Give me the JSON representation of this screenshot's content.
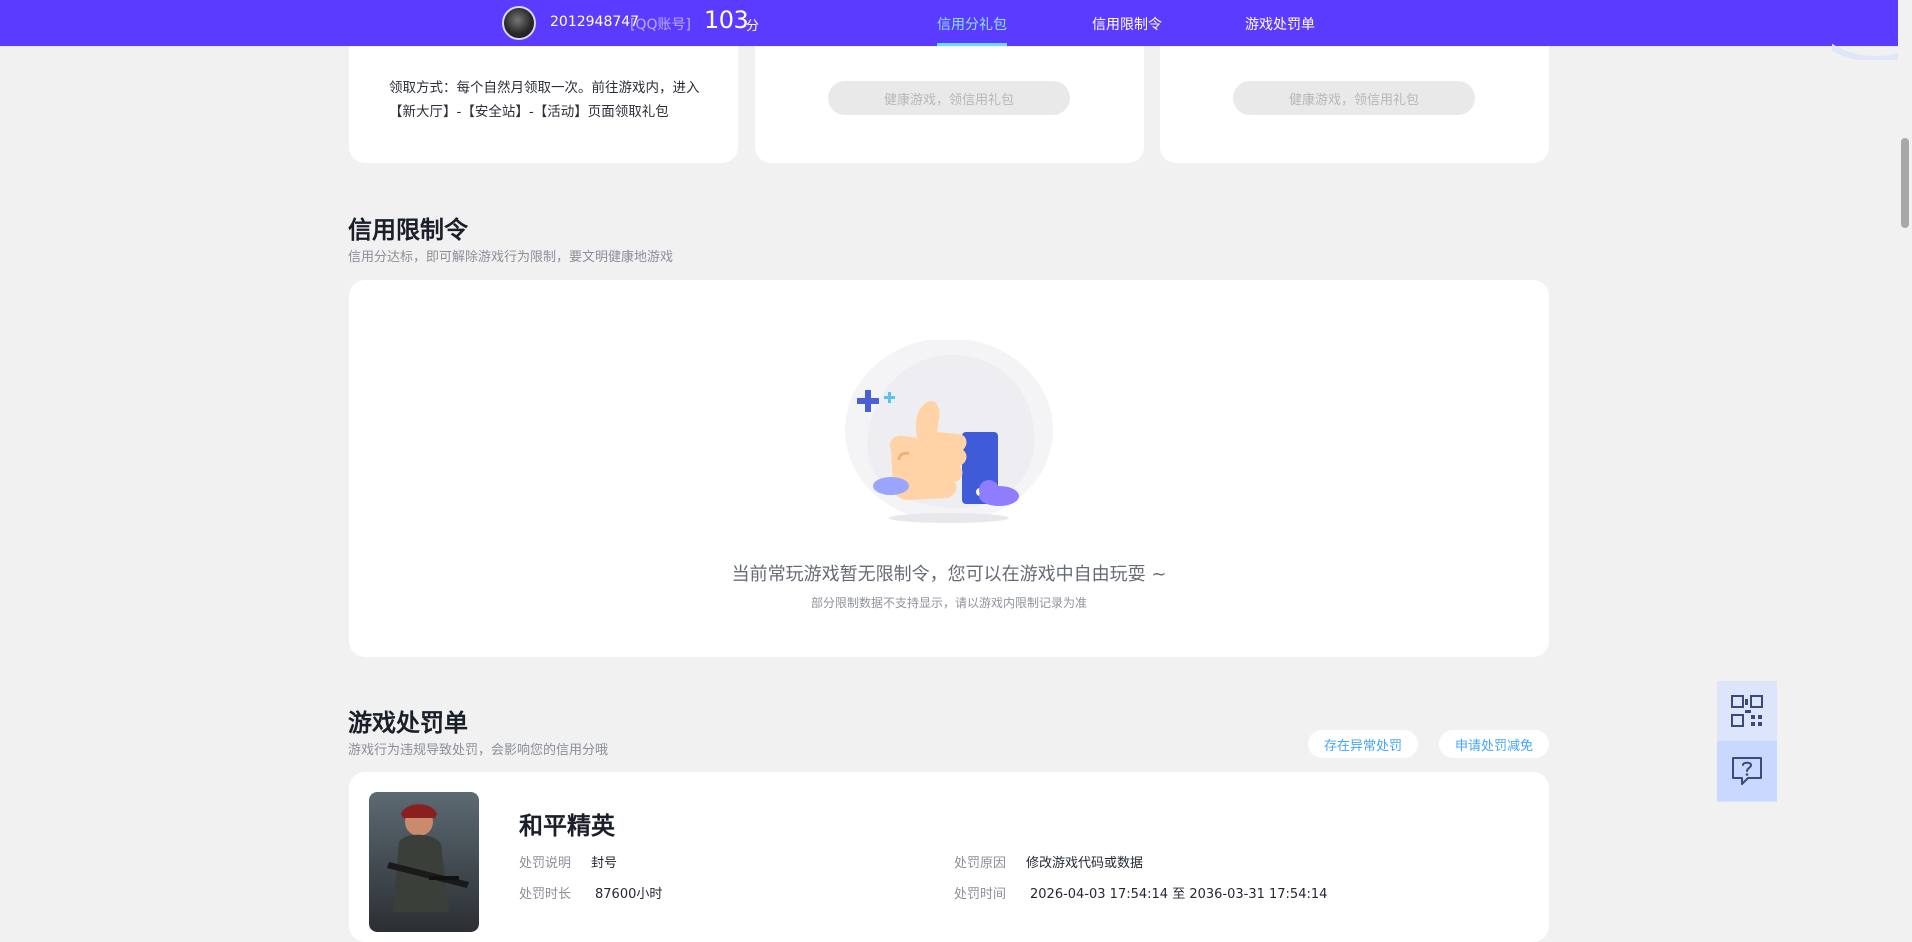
{
  "header": {
    "account_id": "2012948747",
    "account_type": "[QQ账号]",
    "score": "103",
    "score_unit": "分",
    "tabs": [
      {
        "label": "信用分礼包",
        "active": true
      },
      {
        "label": "信用限制令",
        "active": false
      },
      {
        "label": "游戏处罚单",
        "active": false
      }
    ],
    "bg_color": "#5a3bff",
    "active_color": "#8de3ff"
  },
  "gift_cards": {
    "claim_text": "领取方式：每个自然月领取一次。前往游戏内，进入【新大厅】-【安全站】-【活动】页面领取礼包",
    "button_label": "健康游戏，领信用礼包"
  },
  "restriction": {
    "title": "信用限制令",
    "subtitle": "信用分达标，即可解除游戏行为限制，要文明健康地游戏",
    "empty_title": "当前常玩游戏暂无限制令，您可以在游戏中自由玩耍 ~",
    "empty_note": "部分限制数据不支持显示，请以游戏内限制记录为准"
  },
  "penalty": {
    "title": "游戏处罚单",
    "subtitle": "游戏行为违规导致处罚，会影响您的信用分哦",
    "actions": [
      "存在异常处罚",
      "申请处罚减免"
    ],
    "game": {
      "name": "和平精英",
      "desc_label": "处罚说明",
      "desc_value": "封号",
      "reason_label": "处罚原因",
      "reason_value": "修改游戏代码或数据",
      "duration_label": "处罚时长",
      "duration_value": "87600小时",
      "time_label": "处罚时间",
      "time_value": "2026-04-03 17:54:14 至 2036-03-31 17:54:14"
    }
  },
  "side_buttons": [
    {
      "icon": "qr-code-icon"
    },
    {
      "icon": "help-chat-icon"
    }
  ]
}
